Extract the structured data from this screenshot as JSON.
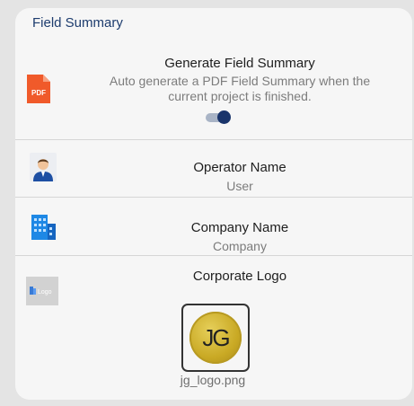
{
  "card": {
    "title": "Field Summary"
  },
  "generate": {
    "icon": "pdf-icon",
    "icon_text": "PDF",
    "label": "Generate Field Summary",
    "description_line1": "Auto generate a PDF Field Summary when the",
    "description_line2": "current project is finished.",
    "toggle_on": true
  },
  "operator": {
    "icon": "person-icon",
    "label": "Operator Name",
    "value": "User"
  },
  "company": {
    "icon": "building-icon",
    "label": "Company Name",
    "value": "Company"
  },
  "corporate_logo": {
    "icon": "logo-thumbnail-icon",
    "icon_text": "Logo",
    "label": "Corporate Logo",
    "logo_text": "JG",
    "filename": "jg_logo.png"
  },
  "colors": {
    "accent": "#19346b",
    "pdf": "#f05a2a",
    "building": "#1e88e5"
  }
}
